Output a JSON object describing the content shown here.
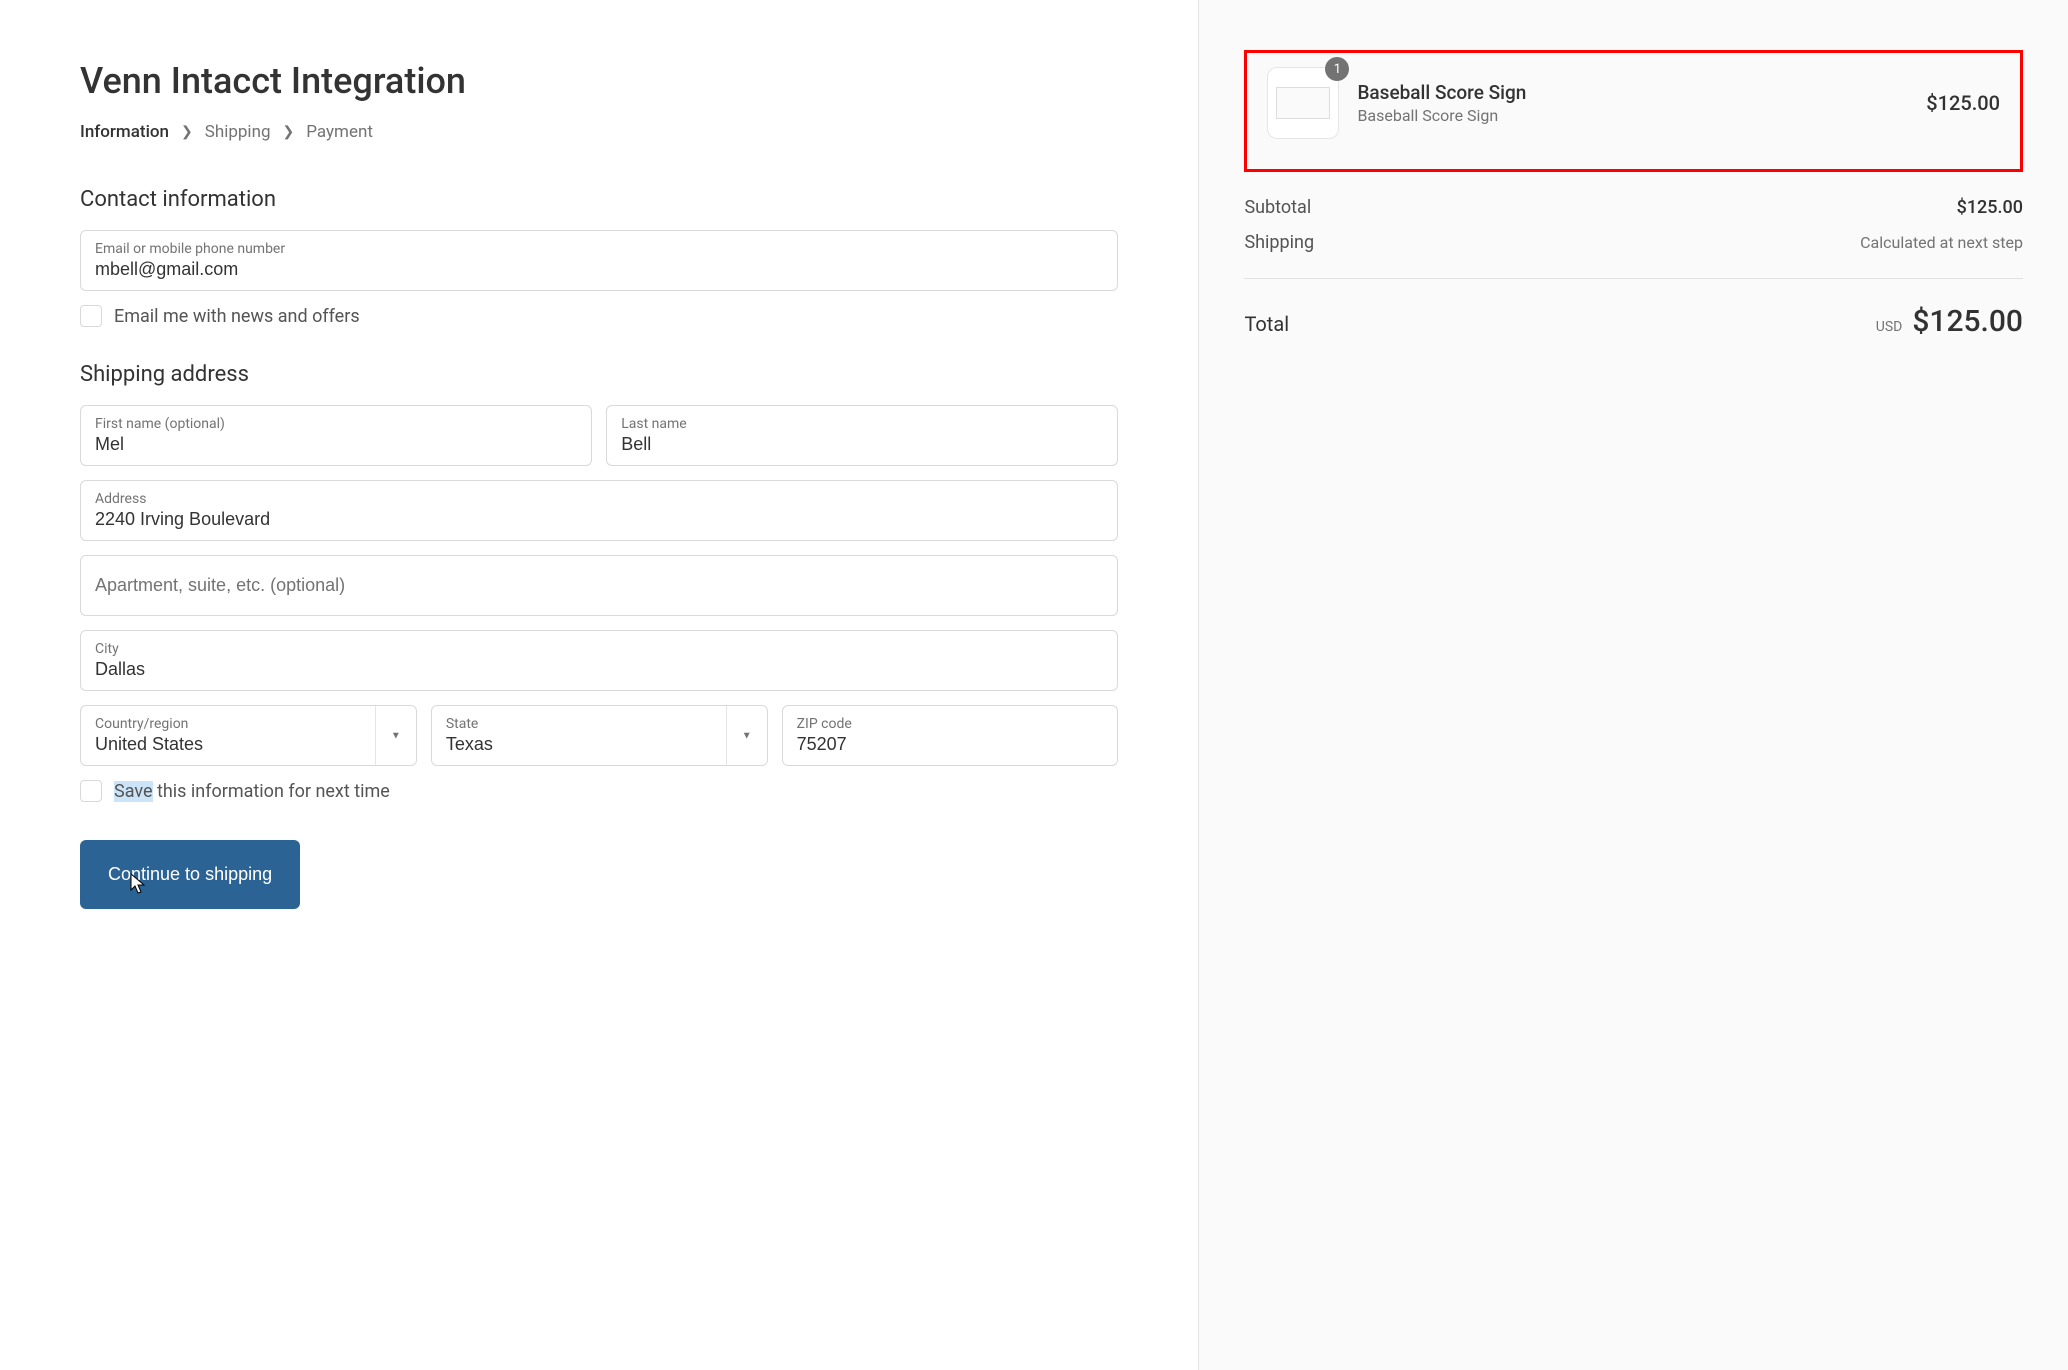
{
  "page_title": "Venn Intacct Integration",
  "breadcrumb": {
    "information": "Information",
    "shipping": "Shipping",
    "payment": "Payment"
  },
  "contact": {
    "heading": "Contact information",
    "email_label": "Email or mobile phone number",
    "email_value": "mbell@gmail.com",
    "news_checkbox_label": "Email me with news and offers"
  },
  "shipping": {
    "heading": "Shipping address",
    "first_name_label": "First name (optional)",
    "first_name_value": "Mel",
    "last_name_label": "Last name",
    "last_name_value": "Bell",
    "address_label": "Address",
    "address_value": "2240 Irving Boulevard",
    "apartment_placeholder": "Apartment, suite, etc. (optional)",
    "city_label": "City",
    "city_value": "Dallas",
    "country_label": "Country/region",
    "country_value": "United States",
    "state_label": "State",
    "state_value": "Texas",
    "zip_label": "ZIP code",
    "zip_value": "75207",
    "save_checkbox_prefix": "Save",
    "save_checkbox_rest": " this information for next time"
  },
  "continue_button": "Continue to shipping",
  "cart": {
    "item_name": "Baseball Score Sign",
    "item_variant": "Baseball Score Sign",
    "item_qty": "1",
    "item_price": "$125.00"
  },
  "summary": {
    "subtotal_label": "Subtotal",
    "subtotal_value": "$125.00",
    "shipping_label": "Shipping",
    "shipping_value": "Calculated at next step",
    "total_label": "Total",
    "total_currency": "USD",
    "total_amount": "$125.00"
  }
}
